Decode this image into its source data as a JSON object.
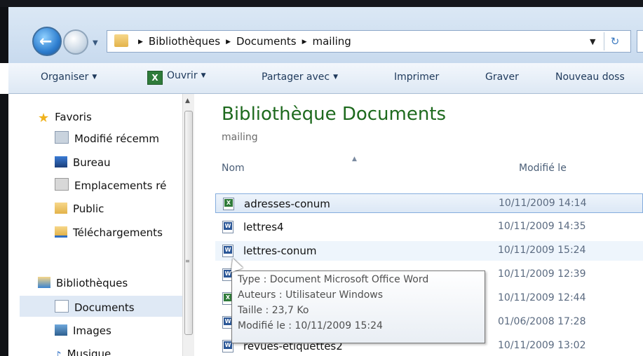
{
  "address": {
    "crumbs": [
      "Bibliothèques",
      "Documents",
      "mailing"
    ]
  },
  "toolbar": {
    "organiser": "Organiser",
    "ouvrir": "Ouvrir",
    "partager": "Partager avec",
    "imprimer": "Imprimer",
    "graver": "Graver",
    "nouveau": "Nouveau doss"
  },
  "nav": {
    "favoris": "Favoris",
    "recent": "Modifié récemm",
    "bureau": "Bureau",
    "emplacements": "Emplacements ré",
    "public": "Public",
    "telechargements": "Téléchargements",
    "bibliotheques": "Bibliothèques",
    "documents": "Documents",
    "images": "Images",
    "musique": "Musique"
  },
  "content": {
    "title": "Bibliothèque Documents",
    "subtitle": "mailing",
    "col_name": "Nom",
    "col_date": "Modifié le",
    "files": [
      {
        "name": "adresses-conum",
        "date": "10/11/2009 14:14",
        "type": "excel"
      },
      {
        "name": "lettres4",
        "date": "10/11/2009 14:35",
        "type": "word"
      },
      {
        "name": "lettres-conum",
        "date": "10/11/2009 15:24",
        "type": "word"
      },
      {
        "name": "",
        "date": "10/11/2009 12:39",
        "type": "word"
      },
      {
        "name": "",
        "date": "10/11/2009 12:44",
        "type": "excel"
      },
      {
        "name": "",
        "date": "01/06/2008 17:28",
        "type": "word"
      },
      {
        "name": "revues-etiquettes2",
        "date": "10/11/2009 13:02",
        "type": "word"
      }
    ]
  },
  "tooltip": {
    "type": "Type : Document Microsoft Office Word",
    "auteurs": "Auteurs : Utilisateur Windows",
    "taille": "Taille : 23,7 Ko",
    "modifie": "Modifié le : 10/11/2009 15:24"
  },
  "icons": {
    "back": "back-arrow-icon",
    "forward": "forward-arrow-icon",
    "refresh": "refresh-icon",
    "favorites": "star-icon"
  }
}
